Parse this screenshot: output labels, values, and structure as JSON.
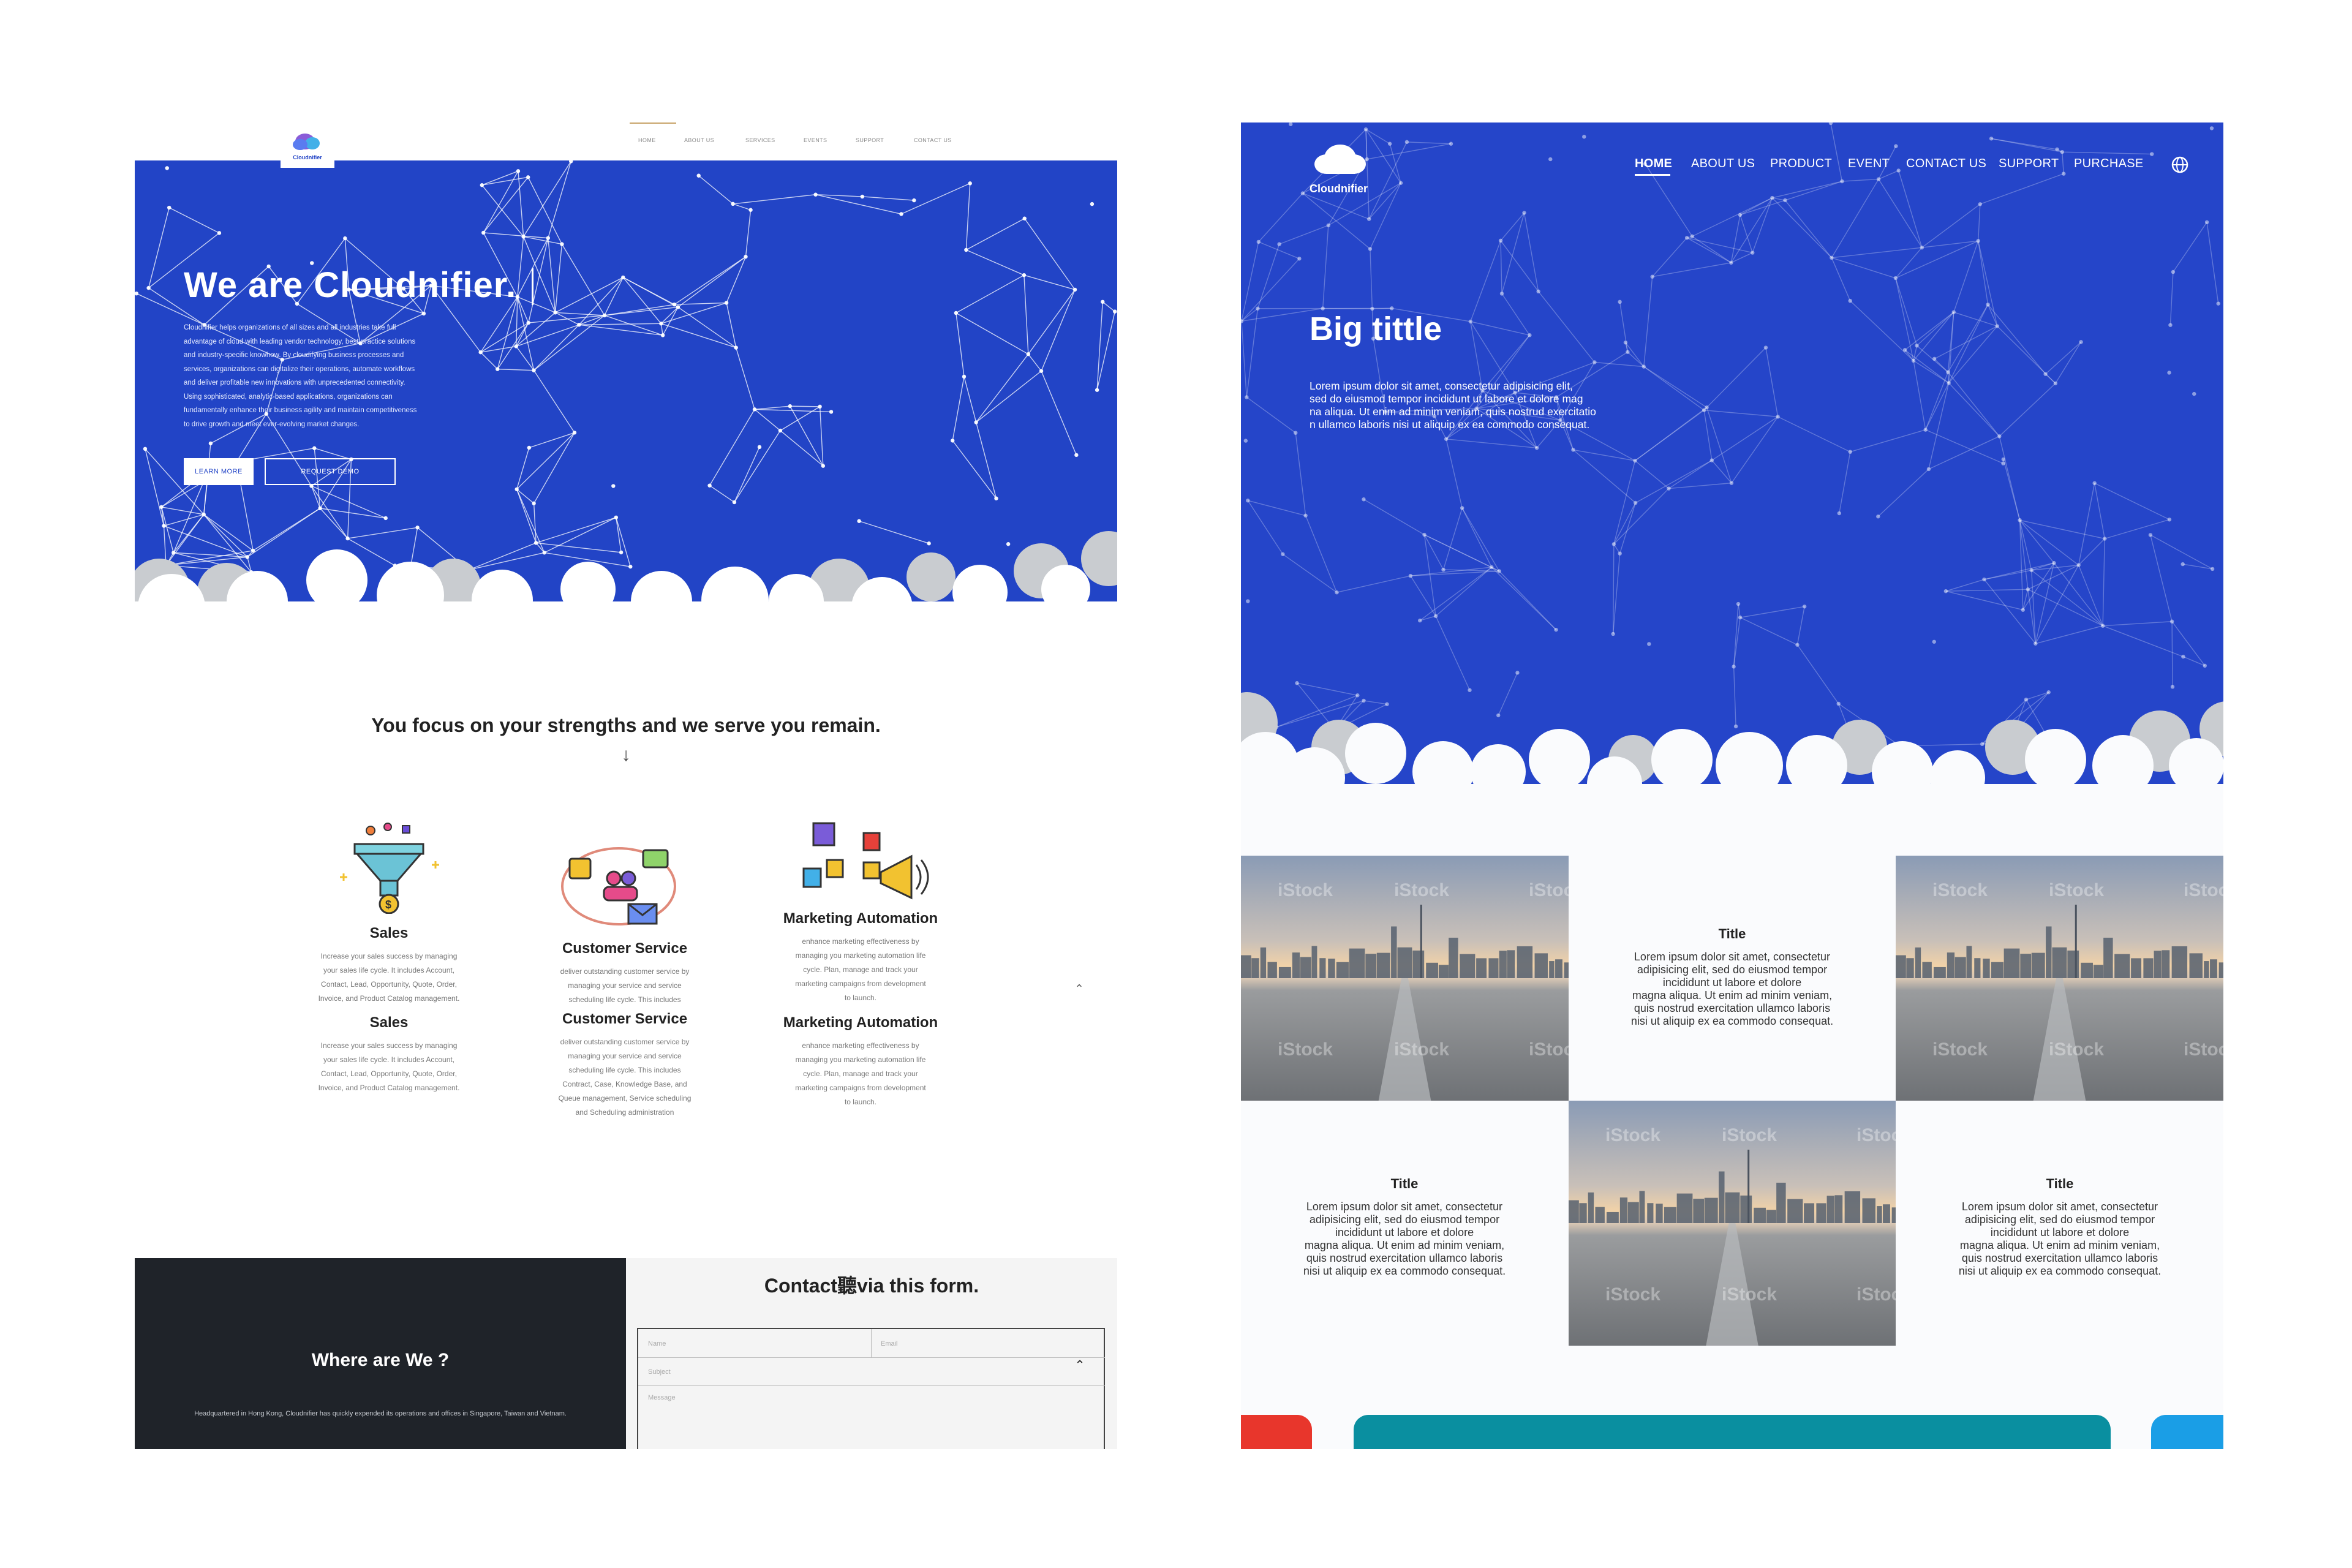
{
  "left_mock": {
    "logo_text": "Cloudnifier",
    "nav": [
      "HOME",
      "ABOUT US",
      "SERVICES",
      "EVENTS",
      "SUPPORT",
      "CONTACT US"
    ],
    "hero_title": "We are Cloudnifier.",
    "hero_body": [
      "Cloudnifier helps organizations of all sizes and all industries take full",
      "advantage of cloud with leading vendor technology, best-practice solutions",
      "and industry-specific knowhow. By cloudifying business processes and",
      "services, organizations can digitalize their operations, automate workflows",
      "and deliver profitable new innovations with unprecedented connectivity.",
      "Using sophisticated, analytic-based applications, organizations can",
      "fundamentally enhance their business agility and maintain competitiveness",
      "to drive growth and meet ever-evolving market changes."
    ],
    "learn_more": "LEARN MORE",
    "request_demo": "REQUEST DEMO",
    "tagline": "You focus on your strengths and we serve you remain.",
    "arrow_glyph": "↓",
    "services": [
      {
        "title": "Sales",
        "desc": [
          "Increase your sales success by managing",
          "your sales life cycle. It includes Account,",
          "Contact, Lead, Opportunity, Quote, Order,",
          "Invoice, and Product Catalog management."
        ],
        "title2": "Sales",
        "desc2": [
          "Increase your sales success by managing",
          "your sales life cycle. It includes Account,",
          "Contact, Lead, Opportunity, Quote, Order,",
          "Invoice, and Product Catalog management."
        ]
      },
      {
        "title": "Customer Service",
        "desc": [
          "deliver outstanding customer service by",
          "managing your service and service",
          "scheduling life cycle. This includes"
        ],
        "title2": "Customer Service",
        "desc2": [
          "deliver outstanding customer service by",
          "managing your service and service",
          "scheduling life cycle. This includes",
          "Contract, Case, Knowledge Base, and",
          "Queue management, Service scheduling",
          "and Scheduling administration"
        ]
      },
      {
        "title": "Marketing Automation",
        "desc": [
          "enhance marketing effectiveness by",
          "managing you marketing automation life",
          "cycle. Plan, manage and track your",
          "marketing campaigns from development",
          "to launch."
        ],
        "title2": "Marketing Automation",
        "desc2": [
          "enhance marketing effectiveness by",
          "managing you marketing automation life",
          "cycle. Plan, manage and track your",
          "marketing campaigns from development",
          "to launch."
        ]
      }
    ],
    "where_title": "Where are We ?",
    "where_text": "Headquartered in Hong Kong, Cloudnifier has quickly expended its operations and offices in Singapore, Taiwan and Vietnam.",
    "contact_title": "Contact聽via this form.",
    "form": {
      "name_placeholder": "Name",
      "email_placeholder": "Email",
      "subject_placeholder": "Subject",
      "message_placeholder": "Message"
    }
  },
  "right_mock": {
    "logo_text": "Cloudnifier",
    "nav": [
      "HOME",
      "ABOUT US",
      "PRODUCT",
      "EVENT",
      "CONTACT US",
      "SUPPORT",
      "PURCHASE"
    ],
    "hero_title": "Big tittle",
    "hero_body": [
      "Lorem ipsum dolor sit amet, consectetur adipisicing elit,",
      "sed do eiusmod tempor incididunt ut labore et dolore mag",
      "na aliqua. Ut enim ad minim veniam, quis nostrud exercitatio",
      "n ullamco laboris nisi ut aliquip ex ea commodo consequat."
    ],
    "photo_watermark": "iStock",
    "cards": [
      {
        "title": "Title",
        "text": [
          "Lorem ipsum dolor sit amet, consectetur",
          "adipisicing elit, sed do eiusmod tempor",
          "incididunt ut labore et dolore",
          "magna aliqua. Ut enim ad minim veniam,",
          "quis nostrud exercitation ullamco laboris",
          "nisi ut aliquip ex ea commodo consequat."
        ]
      },
      {
        "title": "Title",
        "text": [
          "Lorem ipsum dolor sit amet, consectetur",
          "adipisicing elit, sed do eiusmod tempor",
          "incididunt ut labore et dolore",
          "magna aliqua. Ut enim ad minim veniam,",
          "quis nostrud exercitation ullamco laboris",
          "nisi ut aliquip ex ea commodo consequat."
        ]
      },
      {
        "title": "Title",
        "text": [
          "Lorem ipsum dolor sit amet, consectetur",
          "adipisicing elit, sed do eiusmod tempor",
          "incididunt ut labore et dolore",
          "magna aliqua. Ut enim ad minim veniam,",
          "quis nostrud exercitation ullamco laboris",
          "nisi ut aliquip ex ea commodo consequat."
        ]
      }
    ]
  },
  "colors": {
    "hero_blue": "#2244c6",
    "hero_blue_right": "#2545c9",
    "dark_panel": "#1f2329",
    "cloud_grey": "#cdd0d4",
    "teal": "#0a8fa0",
    "red": "#e8362c",
    "sky": "#1a9ee6"
  }
}
